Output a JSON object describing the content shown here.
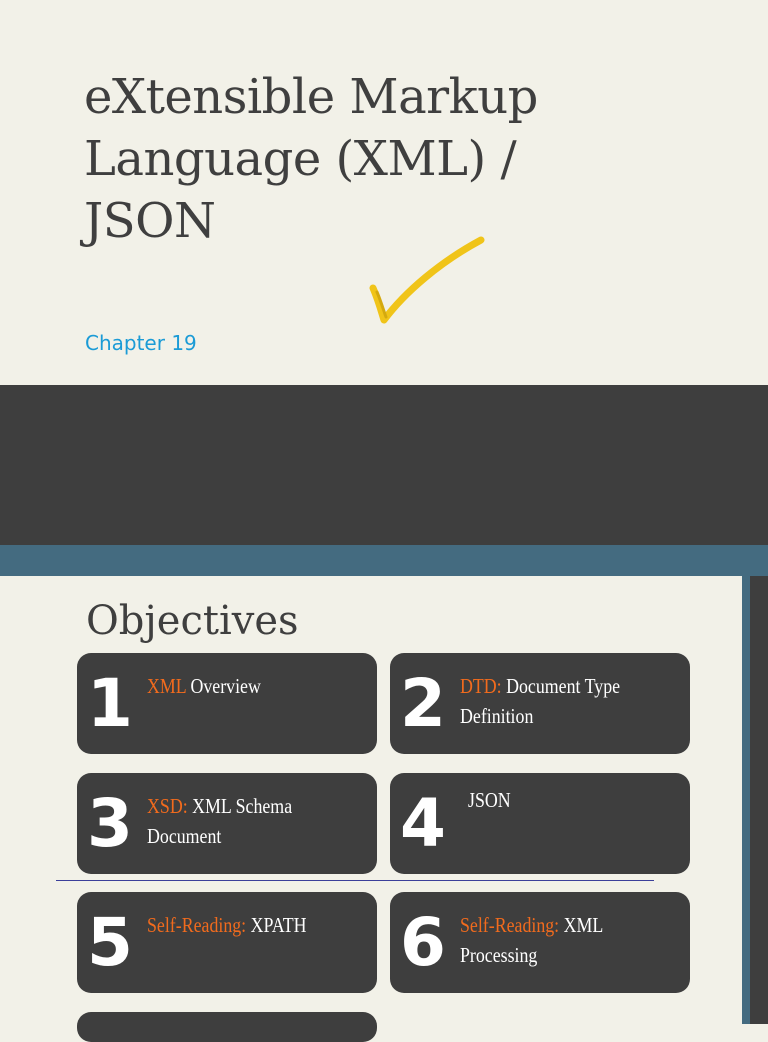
{
  "slide1": {
    "title": "eXtensible Markup\nLanguage (XML) /\nJSON",
    "subtitle": "Chapter 19"
  },
  "slide2": {
    "heading": "Objectives",
    "cards": [
      {
        "num": "1",
        "highlight": "XML",
        "text": " Overview"
      },
      {
        "num": "2",
        "highlight": "DTD:",
        "text": " Document Type Definition"
      },
      {
        "num": "3",
        "highlight": "XSD:",
        "text": " XML Schema Document"
      },
      {
        "num": "4",
        "highlight": "",
        "text": "JSON"
      },
      {
        "num": "5",
        "highlight": "Self-Reading:",
        "text": " XPATH"
      },
      {
        "num": "6",
        "highlight": "Self-Reading:",
        "text": " XML Processing"
      }
    ]
  },
  "colors": {
    "background": "#f2f1e8",
    "dark": "#3e3e3e",
    "accent_blue": "#446b80",
    "highlight_orange": "#f26b1d",
    "subtitle_blue": "#1b9bd6",
    "checkmark_yellow": "#f0c419"
  }
}
